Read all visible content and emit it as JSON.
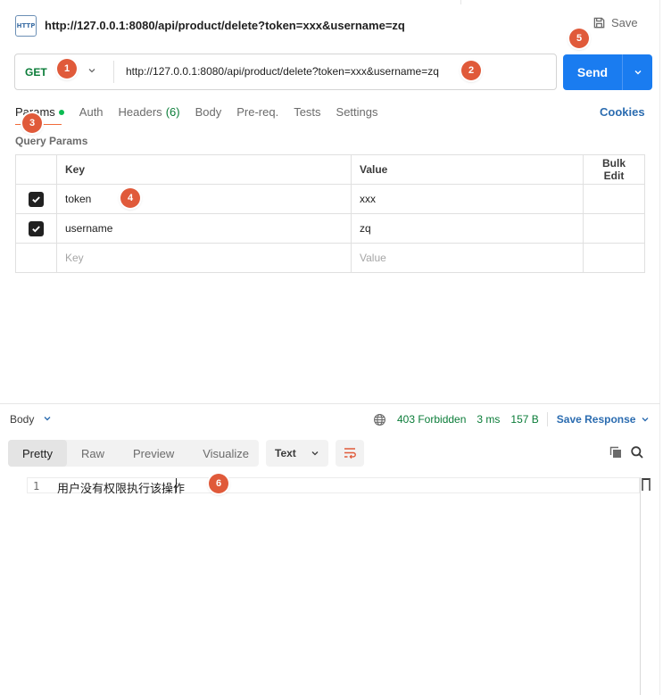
{
  "header": {
    "title_url": "http://127.0.0.1:8080/api/product/delete?token=xxx&username=zq",
    "http_icon_text": "HTTP",
    "save_label": "Save"
  },
  "request": {
    "method": "GET",
    "url": "http://127.0.0.1:8080/api/product/delete?token=xxx&username=zq",
    "send_label": "Send"
  },
  "tabs": [
    {
      "label": "Params",
      "count": "",
      "active": true
    },
    {
      "label": "Auth",
      "count": ""
    },
    {
      "label": "Headers",
      "count": "(6)"
    },
    {
      "label": "Body",
      "count": ""
    },
    {
      "label": "Pre-req.",
      "count": ""
    },
    {
      "label": "Tests",
      "count": ""
    },
    {
      "label": "Settings",
      "count": ""
    }
  ],
  "cookies_label": "Cookies",
  "query_params": {
    "title": "Query Params",
    "columns": {
      "key": "Key",
      "value": "Value",
      "bulk": "Bulk Edit"
    },
    "rows": [
      {
        "key": "token",
        "value": "xxx",
        "checked": true
      },
      {
        "key": "username",
        "value": "zq",
        "checked": true
      }
    ],
    "placeholder": {
      "key": "Key",
      "value": "Value"
    }
  },
  "response": {
    "body_label": "Body",
    "status": "403 Forbidden",
    "time": "3 ms",
    "size": "157 B",
    "save_response_label": "Save Response",
    "view_tabs": [
      "Pretty",
      "Raw",
      "Preview",
      "Visualize"
    ],
    "active_view": "Pretty",
    "format": "Text",
    "lines": [
      {
        "num": "1",
        "text": "用户没有权限执行该操作"
      }
    ]
  },
  "markers": [
    "1",
    "2",
    "3",
    "4",
    "5",
    "6"
  ],
  "colors": {
    "send": "#1a7cf0",
    "method": "#0a7c38",
    "status": "#0a7c38",
    "link": "#2b6cb0",
    "marker": "#e05a3a",
    "active_tab_underline": "#f26b3a"
  }
}
